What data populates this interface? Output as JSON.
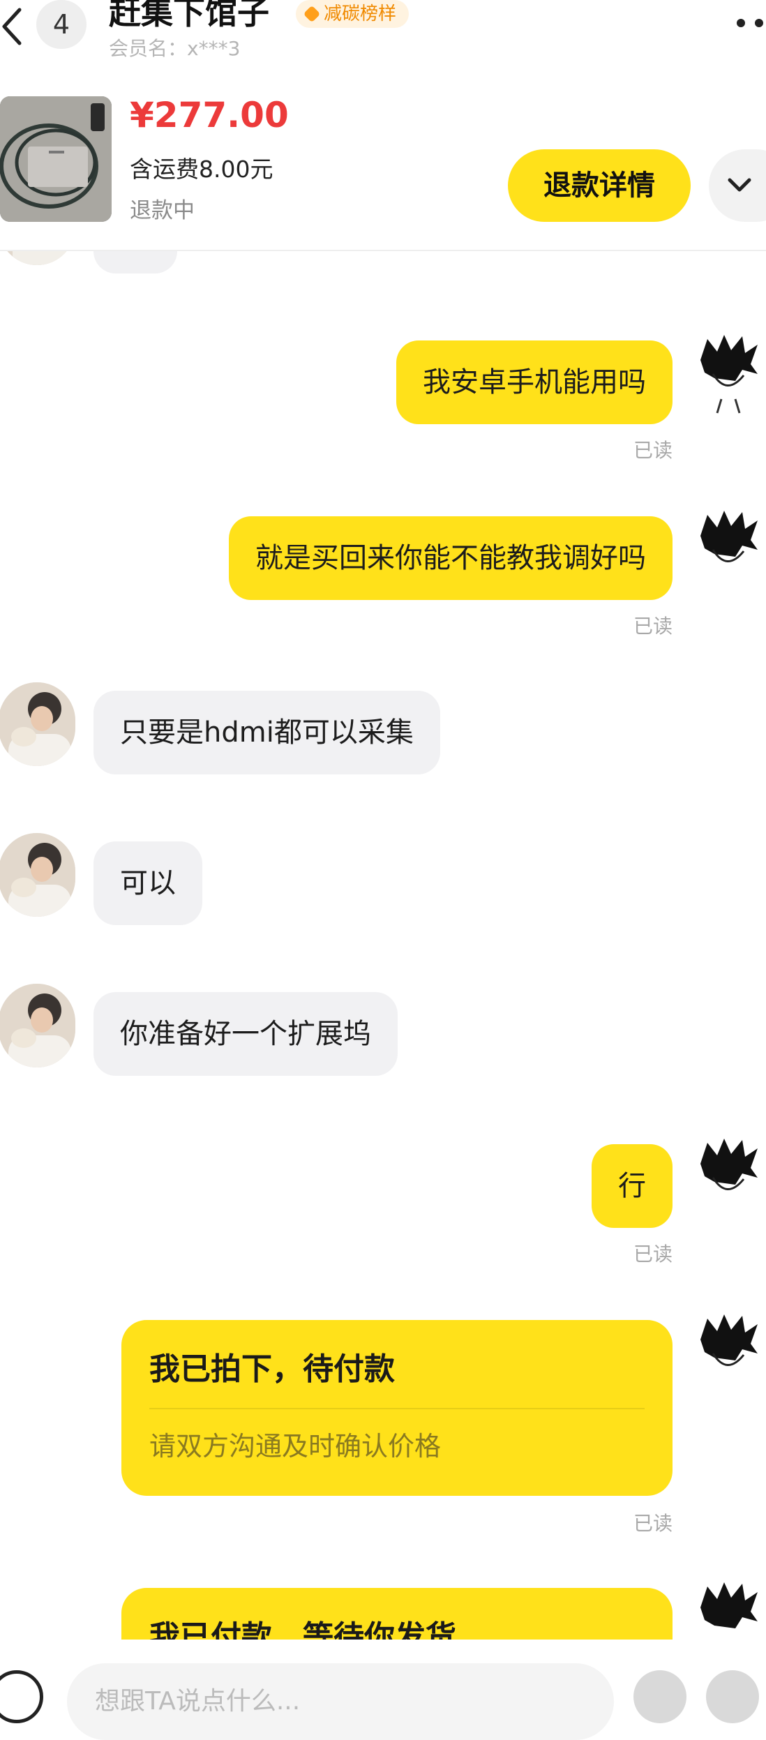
{
  "header": {
    "unread_count": "4",
    "shop_name": "赶集下馆子",
    "badge": "减碳榜样",
    "member": "会员名：x***3"
  },
  "product": {
    "price": "¥277.00",
    "shipping": "含运费8.00元",
    "status": "退款中",
    "refund_button": "退款详情"
  },
  "messages": [
    {
      "side": "out",
      "text": "我安卓手机能用吗",
      "read": "已读"
    },
    {
      "side": "out",
      "text": "就是买回来你能不能教我调好吗",
      "read": "已读"
    },
    {
      "side": "in",
      "text": "只要是hdmi都可以采集"
    },
    {
      "side": "in",
      "text": "可以"
    },
    {
      "side": "in",
      "text": "你准备好一个扩展坞"
    },
    {
      "side": "out",
      "text": "行",
      "read": "已读"
    }
  ],
  "order_cards": [
    {
      "title": "我已拍下，待付款",
      "subtitle": "请双方沟通及时确认价格",
      "read": "已读"
    },
    {
      "title": "我已付款，等待你发货"
    }
  ],
  "input": {
    "placeholder": "想跟TA说点什么..."
  },
  "colors": {
    "accent_yellow": "#ffe11a",
    "price_red": "#ec3a3a",
    "incoming_bubble": "#f1f1f3"
  }
}
